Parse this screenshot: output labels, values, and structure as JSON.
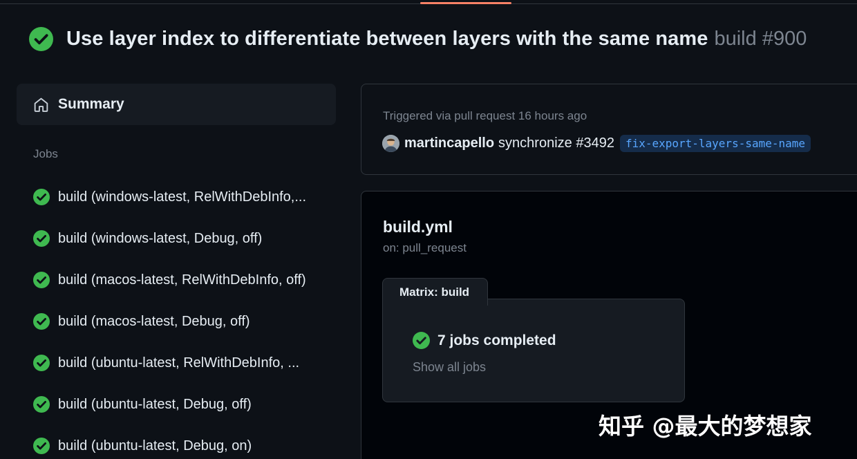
{
  "run": {
    "title": "Use layer index to differentiate between layers with the same name",
    "build_label": "build #900",
    "status": "success"
  },
  "sidebar": {
    "summary_label": "Summary",
    "jobs_heading": "Jobs",
    "jobs": [
      {
        "label": "build (windows-latest, RelWithDebInfo,...",
        "status": "success"
      },
      {
        "label": "build (windows-latest, Debug, off)",
        "status": "success"
      },
      {
        "label": "build (macos-latest, RelWithDebInfo, off)",
        "status": "success"
      },
      {
        "label": "build (macos-latest, Debug, off)",
        "status": "success"
      },
      {
        "label": "build (ubuntu-latest, RelWithDebInfo, ...",
        "status": "success"
      },
      {
        "label": "build (ubuntu-latest, Debug, off)",
        "status": "success"
      },
      {
        "label": "build (ubuntu-latest, Debug, on)",
        "status": "success"
      }
    ]
  },
  "trigger": {
    "text": "Triggered via pull request 16 hours ago",
    "actor": "martincapello",
    "event": "synchronize #3492",
    "branch": "fix-export-layers-same-name"
  },
  "workflow": {
    "file": "build.yml",
    "on": "on: pull_request",
    "matrix_tab": "Matrix: build",
    "status_text": "7 jobs completed",
    "show_all": "Show all jobs"
  },
  "watermark": "知乎 @最大的梦想家",
  "icons": {
    "status": "check-circle-fill-icon",
    "summary": "home-icon",
    "avatar": "user-avatar"
  },
  "colors": {
    "background": "#0d1117",
    "success": "#3fb950",
    "link": "#58a6ff",
    "muted": "#7d8590",
    "border": "#30363d",
    "tab_accent": "#f78166"
  }
}
